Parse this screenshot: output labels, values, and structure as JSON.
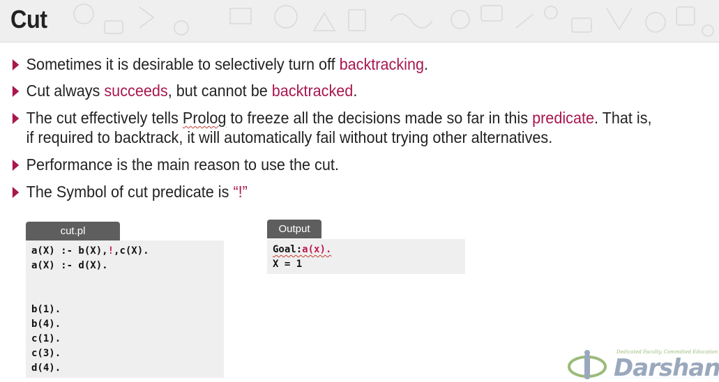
{
  "slide": {
    "title": "Cut"
  },
  "bullets": [
    {
      "parts": [
        "Sometimes it is desirable to selectively turn off ",
        "backtracking",
        "."
      ]
    },
    {
      "parts": [
        "Cut always ",
        "succeeds",
        ", but cannot be ",
        "backtracked",
        "."
      ]
    },
    {
      "parts": [
        "The cut effectively tells ",
        "Prolog",
        " to freeze all the decisions made so far in this ",
        "predicate",
        ". That is,",
        "if required to backtrack, it will automatically fail without trying other alternatives."
      ]
    },
    {
      "parts": [
        "Performance is the main reason to use the cut."
      ]
    },
    {
      "parts": [
        "The Symbol of cut predicate is ",
        "“!”"
      ]
    }
  ],
  "cut_panel": {
    "tab_label": "cut.pl",
    "line1_a": "a(X) :- b(X),",
    "line1_cut": "!",
    "line1_b": ",c(X).",
    "line2": "a(X) :- d(X).",
    "facts": [
      "b(1).",
      "b(4).",
      "c(1).",
      "c(3).",
      "d(4)."
    ]
  },
  "output_panel": {
    "tab_label": "Output",
    "goal_label": "Goal:",
    "goal_query": "a(x).",
    "result": "X = 1"
  },
  "logo": {
    "tagline": "Dedicated Faculty, Committed Education",
    "name": "Darshan"
  },
  "colors": {
    "accent": "#a8174e",
    "code_bg": "#efefef",
    "tab_bg": "#5e5e5e"
  }
}
